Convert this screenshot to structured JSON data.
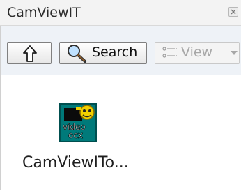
{
  "window": {
    "title": "CamViewIT"
  },
  "toolbar": {
    "up_icon": "up-arrow-icon",
    "search_label": "Search",
    "view_label": "View",
    "view_menu_icon": "dropdown-arrow-icon"
  },
  "content": {
    "items": [
      {
        "label": "CamViewITo...",
        "icon": "video-ocx-file-icon",
        "icon_text_line1": "video",
        "icon_text_line2": "ocx"
      }
    ]
  }
}
